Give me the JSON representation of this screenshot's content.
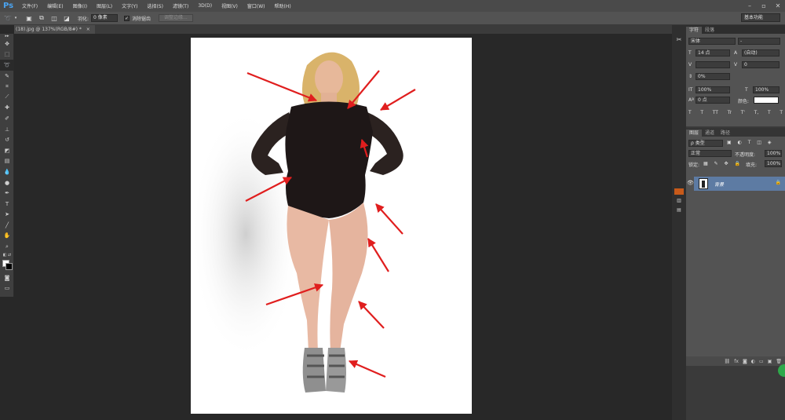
{
  "app": {
    "logo": "Ps",
    "workspace": "基本功能"
  },
  "menu": [
    "文件(F)",
    "编辑(E)",
    "图像(I)",
    "图层(L)",
    "文字(Y)",
    "选择(S)",
    "滤镜(T)",
    "3D(D)",
    "视图(V)",
    "窗口(W)",
    "帮助(H)"
  ],
  "options": {
    "feather_label": "羽化:",
    "feather_value": "0 像素",
    "antialias_label": "消除锯齿",
    "refine_edge": "调整边缘..."
  },
  "document": {
    "tab_title": "(18).jpg @ 137%(RGB/8#) *"
  },
  "character_panel": {
    "tabs": [
      "字符",
      "段落"
    ],
    "font_family": "宋体",
    "font_style": "-",
    "font_size": "14 点",
    "leading": "(自动)",
    "tracking": "0",
    "scale_pct": "0%",
    "vertical_scale": "100%",
    "horizontal_scale": "100%",
    "baseline": "0 点",
    "color_label": "颜色:",
    "style_buttons": [
      "T",
      "T",
      "TT",
      "Tr",
      "T'",
      "T,",
      "T",
      "T"
    ]
  },
  "layers_panel": {
    "tabs": [
      "图层",
      "通道",
      "路径"
    ],
    "filter": "ρ 类型",
    "blend_mode": "正常",
    "opacity_label": "不透明度:",
    "opacity_value": "100%",
    "lock_label": "锁定:",
    "fill_label": "填充:",
    "fill_value": "100%",
    "layers": [
      {
        "name": "背景",
        "visible": true,
        "locked": true
      }
    ]
  },
  "colors": {
    "accent": "#5d7ba3",
    "arrow": "#e01e1e",
    "ps_blue": "#4aa3f0"
  }
}
